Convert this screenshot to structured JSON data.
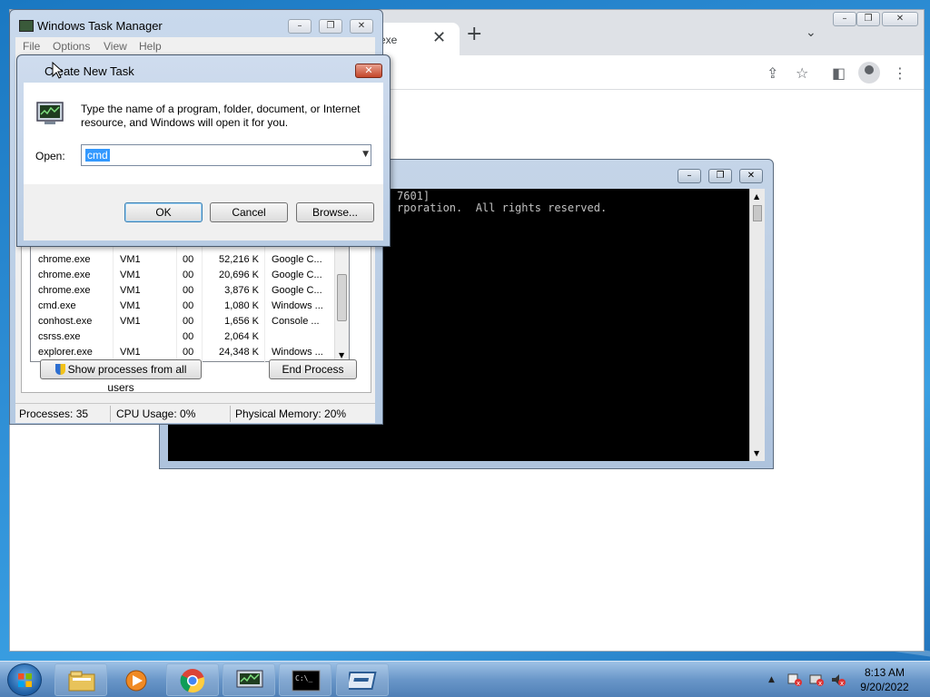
{
  "chrome": {
    "tab_title": "exe",
    "tab_close": "✕",
    "new_tab": "+",
    "tab_search": "⌄",
    "toolbar_icons": {
      "share": "⇪",
      "star": "☆",
      "sidepanel": "◧",
      "menu": "⋮"
    },
    "window_controls": {
      "minimize": "–",
      "restore": "❐",
      "close": "✕"
    }
  },
  "console": {
    "lines": [
      "[Version 6.1.7601]",
      "Microsoft Corporation.  All rights reserved."
    ],
    "visible_lines": [
      "7601]",
      "rporation.  All rights reserved."
    ],
    "controls": {
      "minimize": "–",
      "restore": "❐",
      "close": "✕"
    }
  },
  "task_manager": {
    "title": "Windows Task Manager",
    "menu": [
      "File",
      "Options",
      "View",
      "Help"
    ],
    "controls": {
      "minimize": "–",
      "restore": "❐",
      "close": "✕"
    },
    "processes": [
      {
        "name": "chrome.exe",
        "user": "VM1",
        "cpu": "00",
        "mem": "52,216 K",
        "desc": "Google C..."
      },
      {
        "name": "chrome.exe",
        "user": "VM1",
        "cpu": "00",
        "mem": "20,696 K",
        "desc": "Google C..."
      },
      {
        "name": "chrome.exe",
        "user": "VM1",
        "cpu": "00",
        "mem": "3,876 K",
        "desc": "Google C..."
      },
      {
        "name": "cmd.exe",
        "user": "VM1",
        "cpu": "00",
        "mem": "1,080 K",
        "desc": "Windows ..."
      },
      {
        "name": "conhost.exe",
        "user": "VM1",
        "cpu": "00",
        "mem": "1,656 K",
        "desc": "Console ..."
      },
      {
        "name": "csrss.exe",
        "user": "",
        "cpu": "00",
        "mem": "2,064 K",
        "desc": ""
      },
      {
        "name": "explorer.exe",
        "user": "VM1",
        "cpu": "00",
        "mem": "24,348 K",
        "desc": "Windows ..."
      }
    ],
    "show_all_button": "Show processes from all users",
    "end_process_button": "End Process",
    "status": {
      "processes": "Processes: 35",
      "cpu": "CPU Usage: 0%",
      "memory": "Physical Memory: 20%"
    }
  },
  "dialog": {
    "title": "Create New Task",
    "close": "✕",
    "description": "Type the name of a program, folder, document, or Internet resource, and Windows will open it for you.",
    "open_label": "Open:",
    "input_value": "cmd",
    "dropdown_arrow": "▼",
    "ok": "OK",
    "cancel": "Cancel",
    "browse": "Browse..."
  },
  "taskbar": {
    "time": "8:13 AM",
    "date": "9/20/2022",
    "tray_expand": "▲",
    "items": [
      "explorer-icon",
      "media-player-icon",
      "chrome-icon",
      "task-manager-icon",
      "cmd-icon",
      "run-dialog-icon"
    ]
  }
}
